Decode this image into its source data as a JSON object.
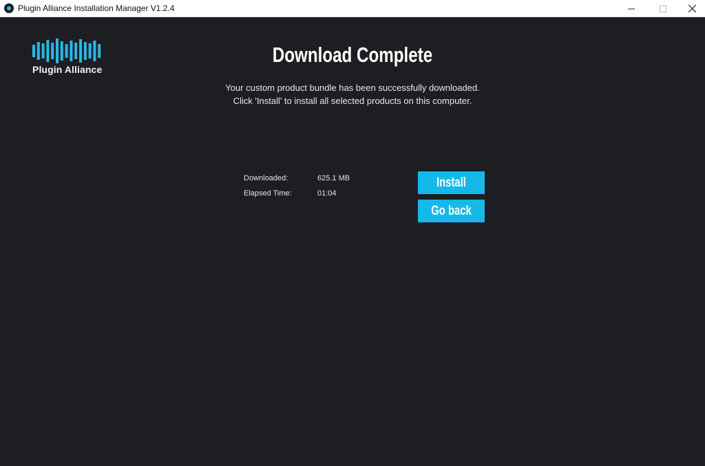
{
  "window": {
    "title": "Plugin Alliance Installation Manager V1.2.4",
    "controls": {
      "minimize": "—",
      "maximize": "☐",
      "close": "✕"
    }
  },
  "logo": {
    "text": "Plugin Alliance",
    "bar_color": "#2ab7e6"
  },
  "main": {
    "heading": "Download Complete",
    "message_line1": "Your custom product bundle has been successfully downloaded.",
    "message_line2": "Click 'Install' to install all selected products on this computer."
  },
  "stats": [
    {
      "label": "Downloaded:",
      "value": "625.1 MB"
    },
    {
      "label": "Elapsed Time:",
      "value": "01:04"
    }
  ],
  "buttons": {
    "install": "Install",
    "go_back": "Go back"
  },
  "colors": {
    "background": "#1d1e21",
    "accent": "#14b9ea",
    "text": "#ffffff"
  }
}
